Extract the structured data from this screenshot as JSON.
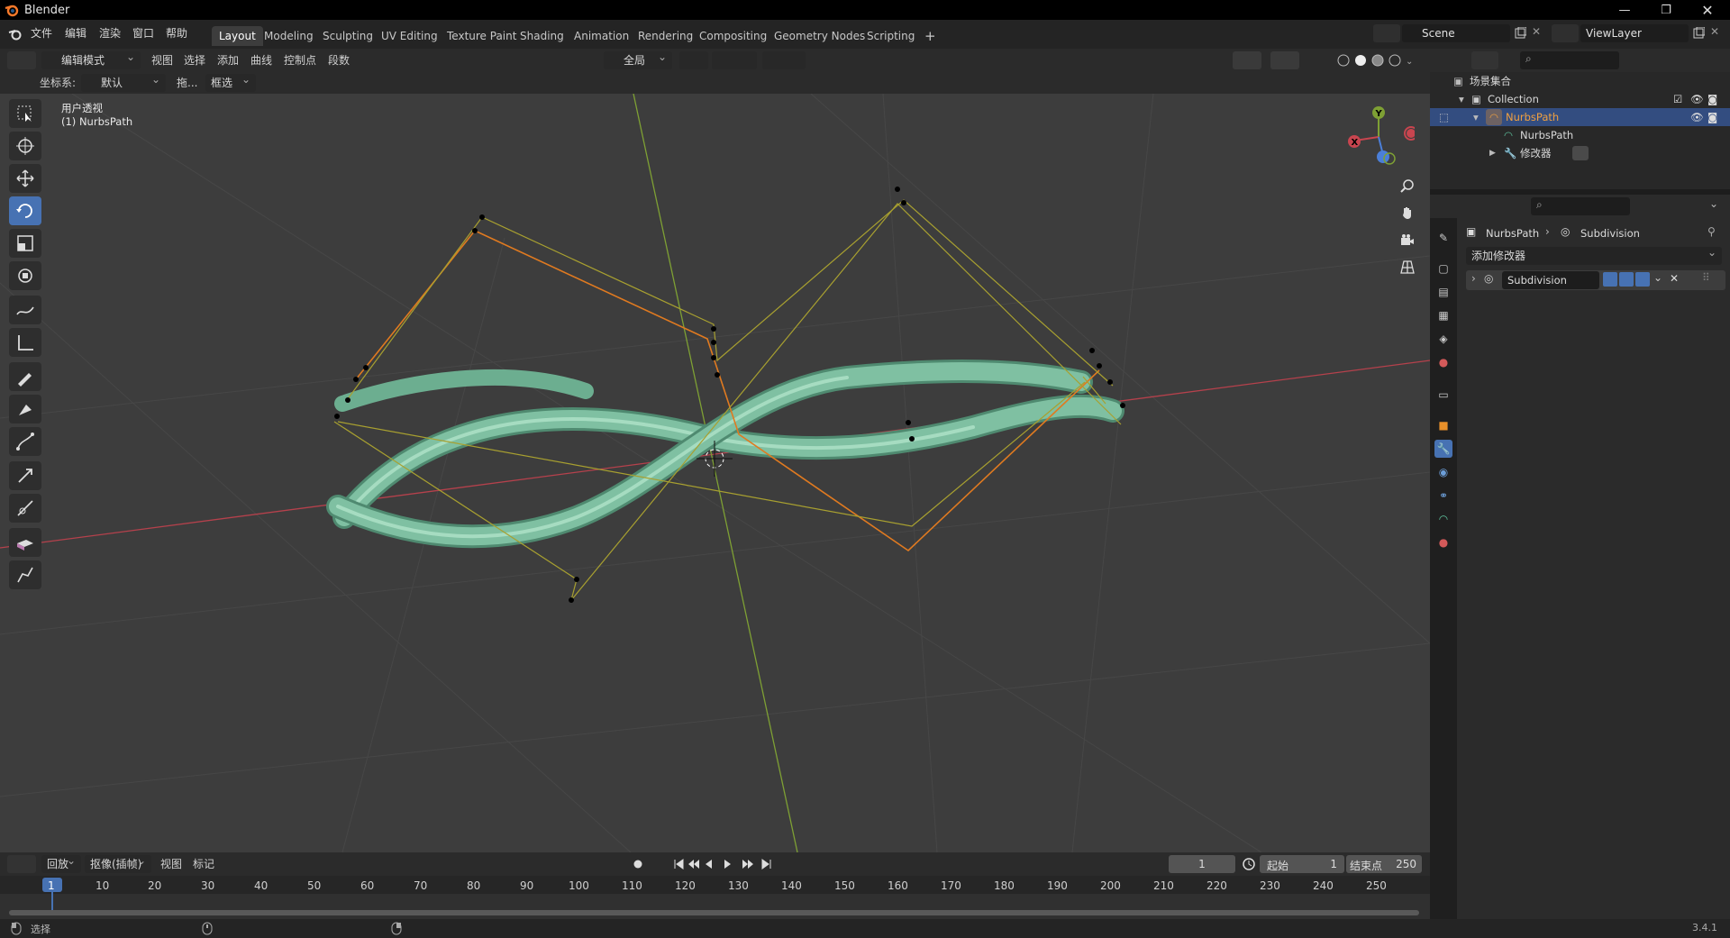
{
  "app": {
    "title": "Blender",
    "version": "3.4.1"
  },
  "topbar": {
    "menus": [
      "文件",
      "编辑",
      "渲染",
      "窗口",
      "帮助"
    ],
    "workspaces": [
      "Layout",
      "Modeling",
      "Sculpting",
      "UV Editing",
      "Texture Paint",
      "Shading",
      "Animation",
      "Rendering",
      "Compositing",
      "Geometry Nodes",
      "Scripting"
    ],
    "active_workspace": "Layout",
    "add_tab": "+",
    "scene": "Scene",
    "view_layer": "ViewLayer"
  },
  "viewport_header": {
    "mode": "编辑模式",
    "menus": [
      "视图",
      "选择",
      "添加",
      "曲线",
      "控制点",
      "段数"
    ],
    "transform_orientation": "全局"
  },
  "viewport_header2": {
    "coord_label": "坐标系:",
    "coord_value": "默认",
    "drag_label": "拖...",
    "drag_value": "框选"
  },
  "viewport": {
    "view_name": "用户透视",
    "object_label": "(1) NurbsPath",
    "gizmo": {
      "x": "X",
      "y": "Y"
    },
    "colors": {
      "bg": "#3d3d3d",
      "tube": "#7fc0a2",
      "x_axis": "#b5414c",
      "y_axis": "#7ea034",
      "handle_orange": "#e07a20",
      "handle_olive": "#a8a030"
    }
  },
  "timeline": {
    "menus": [
      "回放",
      "抠像(插帧)",
      "视图",
      "标记"
    ],
    "current_frame": "1",
    "start_label": "起始",
    "start_value": "1",
    "end_label": "结束点",
    "end_value": "250",
    "ruler": [
      "1",
      "10",
      "20",
      "30",
      "40",
      "50",
      "60",
      "70",
      "80",
      "90",
      "100",
      "110",
      "120",
      "130",
      "140",
      "150",
      "160",
      "170",
      "180",
      "190",
      "200",
      "210",
      "220",
      "230",
      "240",
      "250"
    ]
  },
  "statusbar": {
    "left": "选择",
    "version": "3.4.1"
  },
  "outliner": {
    "root": "场景集合",
    "collection": "Collection",
    "object": "NurbsPath",
    "data": "NurbsPath",
    "modifiers": "修改器"
  },
  "properties": {
    "breadcrumb_object": "NurbsPath",
    "breadcrumb_modifier": "Subdivision",
    "add_modifier": "添加修改器",
    "modifier_name": "Subdivision"
  }
}
